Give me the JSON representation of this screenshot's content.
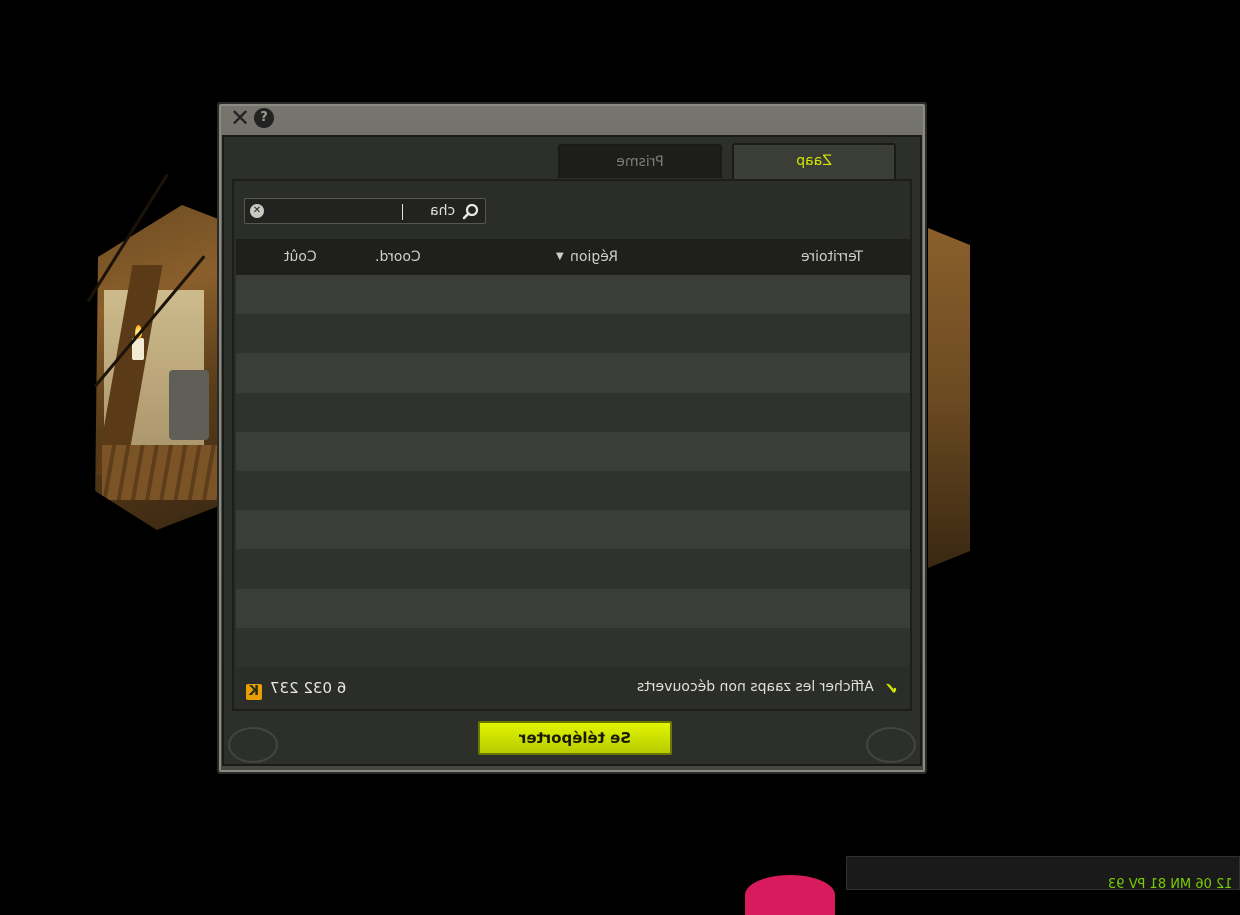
{
  "dialog": {
    "close_icon": "close-icon",
    "help_icon": "help-icon",
    "close_glyph": "✕",
    "help_glyph": "?"
  },
  "tabs": [
    {
      "label": "Zaap",
      "active": true
    },
    {
      "label": "Prisme",
      "active": false
    }
  ],
  "search": {
    "value": "cha",
    "icon": "search-icon",
    "clear_icon": "clear-icon",
    "clear_glyph": "✕"
  },
  "table": {
    "headers": {
      "territoire": "Territoire",
      "region": "Région",
      "coord": "Coord.",
      "cout": "Coût"
    },
    "sort_glyph": "▼",
    "rows": []
  },
  "footer": {
    "kamas": "6 032 237",
    "kamas_icon": "kamas-icon",
    "kamas_glyph": "K",
    "show_undiscovered": "Afficher les zaaps non découverts",
    "show_undiscovered_checked": true,
    "check_glyph": "✔"
  },
  "actions": {
    "teleport": "Se téléporter"
  },
  "colors": {
    "accent": "#d4e600",
    "button": "#c8de00",
    "kamas": "#e5a000"
  },
  "chat": {
    "line": "12 06 MN 81 PV 93"
  }
}
